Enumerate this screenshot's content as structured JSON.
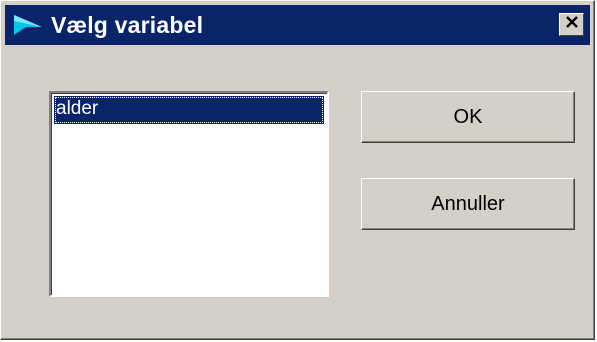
{
  "window": {
    "title": "Vælg variabel",
    "title_icon": "app-icon",
    "close_icon": "close-icon",
    "title_bg": "#0a246a",
    "face_color": "#d4d0c8"
  },
  "listbox": {
    "items": [
      {
        "label": "alder",
        "selected": true
      }
    ]
  },
  "buttons": {
    "ok_label": "OK",
    "cancel_label": "Annuller"
  }
}
